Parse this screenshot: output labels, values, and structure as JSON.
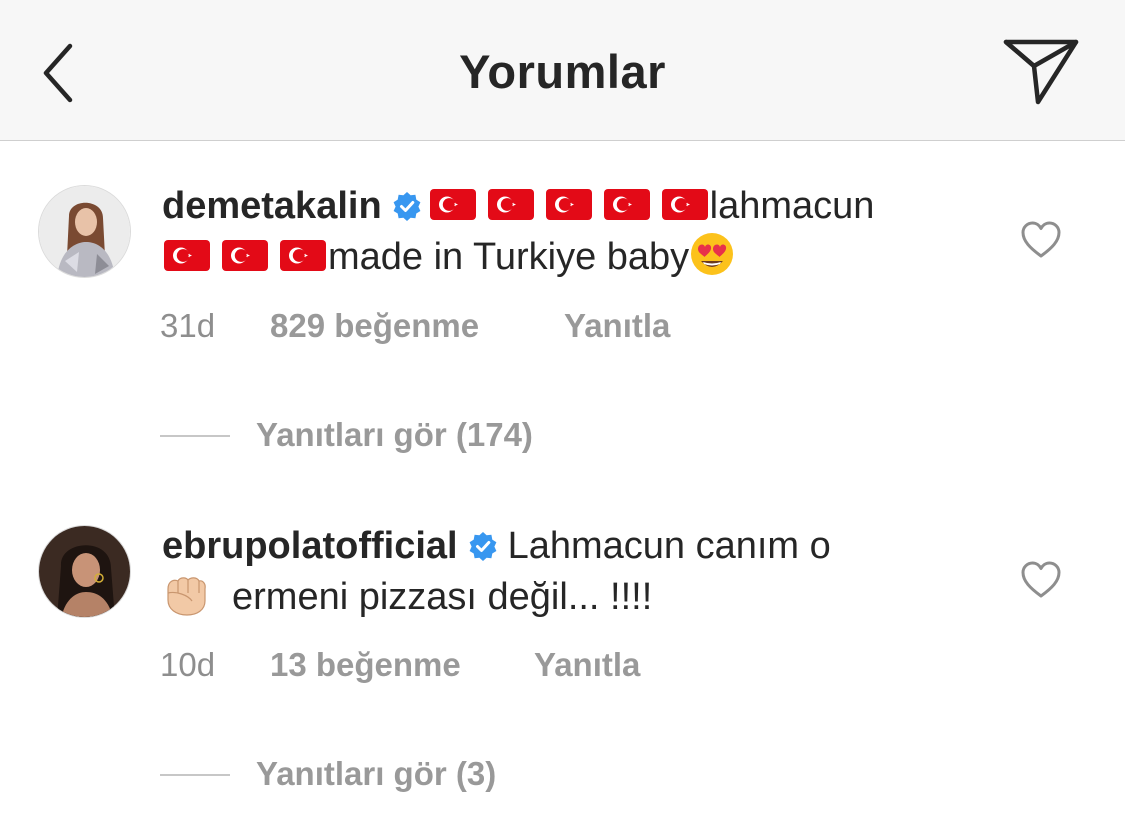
{
  "header": {
    "title": "Yorumlar"
  },
  "comments": [
    {
      "username": "demetakalin",
      "verified": true,
      "text_part1": "lahmacun",
      "text_part2": "made in Turkiye baby",
      "time": "31d",
      "likes": "829 beğenme",
      "reply_label": "Yanıtla",
      "view_replies": "Yanıtları gör (174)"
    },
    {
      "username": "ebrupolatofficial",
      "verified": true,
      "text_part1": "Lahmacun canım o",
      "text_part2": "ermeni pizzası değil... !!!!",
      "time": "10d",
      "likes": "13 beğenme",
      "reply_label": "Yanıtla",
      "view_replies": "Yanıtları gör (3)"
    }
  ],
  "colors": {
    "header_bg": "#f7f7f7",
    "text": "#262626",
    "muted": "#8e8e8e",
    "verified": "#3897f0",
    "flag_red": "#e30a17"
  },
  "icons": [
    "back-chevron-icon",
    "send-icon",
    "verified-badge-icon",
    "turkey-flag-icon",
    "heart-eyes-emoji-icon",
    "fist-emoji-icon",
    "heart-icon"
  ]
}
